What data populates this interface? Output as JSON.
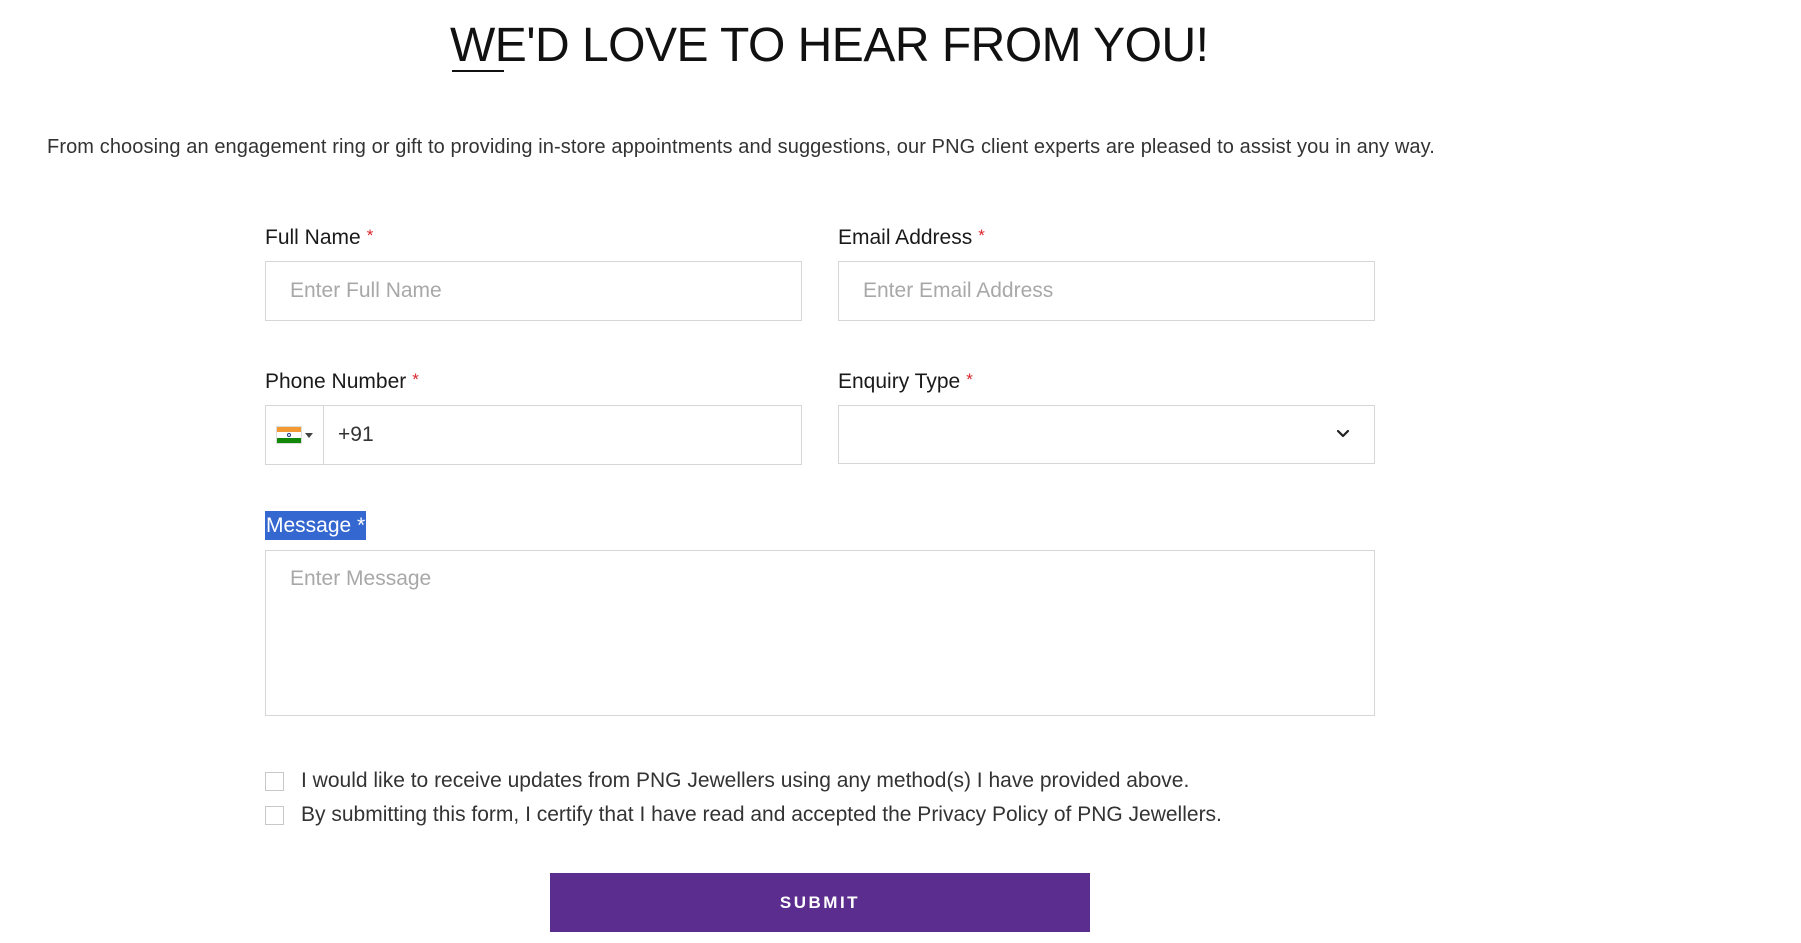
{
  "heading": "WE'D LOVE TO HEAR FROM YOU!",
  "intro": "From choosing an engagement ring or gift to providing in-store appointments and suggestions, our PNG client experts are pleased to assist you in any way.",
  "form": {
    "full_name": {
      "label": "Full Name",
      "required_mark": "*",
      "placeholder": "Enter Full Name",
      "value": ""
    },
    "email": {
      "label": "Email Address",
      "required_mark": "*",
      "placeholder": "Enter Email Address",
      "value": ""
    },
    "phone": {
      "label": "Phone Number",
      "required_mark": "*",
      "country_flag": "india-flag-icon",
      "value": "+91"
    },
    "enquiry_type": {
      "label": "Enquiry Type",
      "required_mark": "*",
      "value": ""
    },
    "message": {
      "label": "Message *",
      "placeholder": "Enter Message",
      "value": ""
    },
    "checkboxes": [
      {
        "text": "I would like to receive updates from PNG Jewellers using any method(s) I have provided above.",
        "checked": false
      },
      {
        "text": "By submitting this form, I certify that I have read and accepted the Privacy Policy of PNG Jewellers.",
        "checked": false
      }
    ],
    "submit_label": "SUBMIT"
  },
  "colors": {
    "accent": "#5b2d8e",
    "required": "#d9262c",
    "selection": "#3467d0"
  }
}
